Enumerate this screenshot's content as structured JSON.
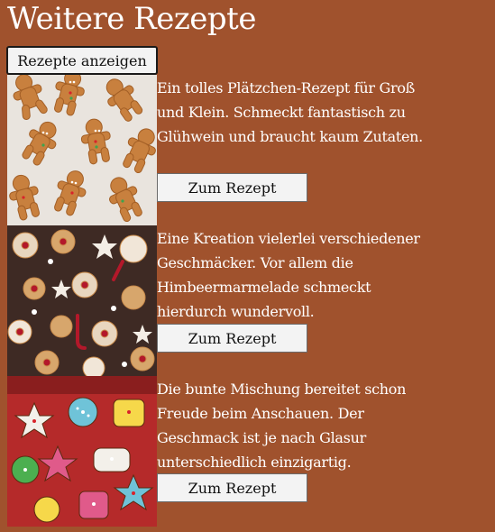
{
  "page": {
    "title": "Weitere Rezepte",
    "background": "#a0522d"
  },
  "toggle_button": {
    "label": "Rezepte anzeigen"
  },
  "recipes": [
    {
      "image": "gingerbread-cookies-photo",
      "description": "Ein tolles Plätzchen-Rezept für Groß und Klein. Schmeckt fantastisch zu Glühwein und braucht kaum Zutaten.",
      "button_label": "Zum Rezept"
    },
    {
      "image": "mixed-christmas-cookies-photo",
      "description": "Eine Kreation vielerlei verschiedener Geschmäcker. Vor allem die Himbeermarmelade schmeckt hierdurch wundervoll.",
      "button_label": "Zum Rezept"
    },
    {
      "image": "decorated-iced-cookies-photo",
      "description": "Die bunte Mischung bereitet schon Freude beim Anschauen. Der Geschmack ist je nach Glasur unterschiedlich einzigartig.",
      "button_label": "Zum Rezept"
    }
  ]
}
